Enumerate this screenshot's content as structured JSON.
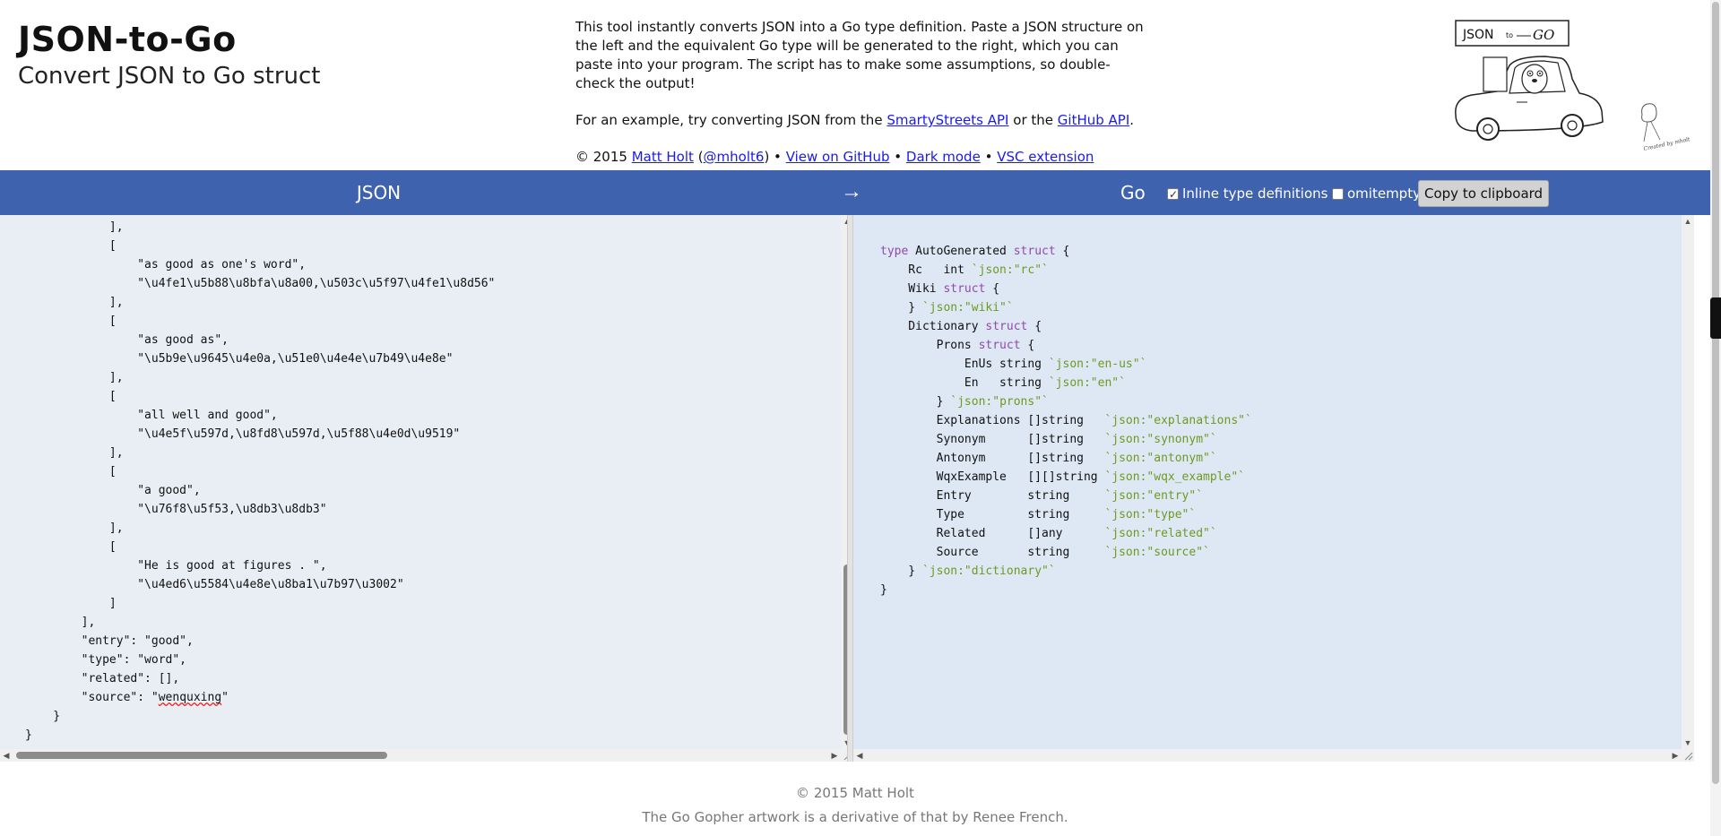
{
  "header": {
    "title": "JSON-to-Go",
    "subtitle": "Convert JSON to Go struct",
    "description": "This tool instantly converts JSON into a Go type definition. Paste a JSON structure on the left and the equivalent Go type will be generated to the right, which you can paste into your program. The script has to make some assumptions, so double-check the output!",
    "example_prefix": "For an example, try converting JSON from the",
    "example_link1": "SmartyStreets API",
    "example_middle": "or the",
    "example_link2": "GitHub API",
    "example_suffix": ".",
    "credits_prefix": "© 2015",
    "author_link": "Matt Holt",
    "handle_open": "(",
    "handle_link": "@mholt6",
    "handle_close": ") •",
    "github_link": "View on GitHub",
    "sep": "•",
    "dark_mode_link": "Dark mode",
    "vsc_link": "VSC extension",
    "logo_text": "JSON",
    "logo_to": "to",
    "logo_go": "GO",
    "logo_caption": "Created by mholt"
  },
  "toolbar": {
    "json_label": "JSON",
    "arrow": "→",
    "go_label": "Go",
    "inline_label": "Inline type definitions",
    "inline_checked": true,
    "omitempty_label": "omitempty",
    "omitempty_checked": false,
    "copy_label": "Copy to clipboard"
  },
  "json_lines": [
    "            ],",
    "            [",
    "                \"as good as one's word\",",
    "                \"\\u4fe1\\u5b88\\u8bfa\\u8a00,\\u503c\\u5f97\\u4fe1\\u8d56\"",
    "            ],",
    "            [",
    "                \"as good as\",",
    "                \"\\u5b9e\\u9645\\u4e0a,\\u51e0\\u4e4e\\u7b49\\u4e8e\"",
    "            ],",
    "            [",
    "                \"all well and good\",",
    "                \"\\u4e5f\\u597d,\\u8fd8\\u597d,\\u5f88\\u4e0d\\u9519\"",
    "            ],",
    "            [",
    "                \"a good\",",
    "                \"\\u76f8\\u5f53,\\u8db3\\u8db3\"",
    "            ],",
    "            [",
    "                \"He is good at figures . \",",
    "                \"\\u4ed6\\u5584\\u4e8e\\u8ba1\\u7b97\\u3002\"",
    "            ]",
    "        ],",
    "        \"entry\": \"good\",",
    "        \"type\": \"word\",",
    "        \"related\": [],",
    "        \"source\": \"wenquxing\"",
    "    }",
    "}"
  ],
  "go_lines": [
    [
      {
        "t": "type",
        "c": "kw"
      },
      {
        "t": " AutoGenerated "
      },
      {
        "t": "struct",
        "c": "kw"
      },
      {
        "t": " {"
      }
    ],
    [
      {
        "t": "    Rc   int "
      },
      {
        "t": "`json:\"rc\"`",
        "c": "tag"
      }
    ],
    [
      {
        "t": "    Wiki "
      },
      {
        "t": "struct",
        "c": "kw"
      },
      {
        "t": " {"
      }
    ],
    [
      {
        "t": "    } "
      },
      {
        "t": "`json:\"wiki\"`",
        "c": "tag"
      }
    ],
    [
      {
        "t": "    Dictionary "
      },
      {
        "t": "struct",
        "c": "kw"
      },
      {
        "t": " {"
      }
    ],
    [
      {
        "t": "        Prons "
      },
      {
        "t": "struct",
        "c": "kw"
      },
      {
        "t": " {"
      }
    ],
    [
      {
        "t": "            EnUs string "
      },
      {
        "t": "`json:\"en-us\"`",
        "c": "tag"
      }
    ],
    [
      {
        "t": "            En   string "
      },
      {
        "t": "`json:\"en\"`",
        "c": "tag"
      }
    ],
    [
      {
        "t": "        } "
      },
      {
        "t": "`json:\"prons\"`",
        "c": "tag"
      }
    ],
    [
      {
        "t": "        Explanations []string   "
      },
      {
        "t": "`json:\"explanations\"`",
        "c": "tag"
      }
    ],
    [
      {
        "t": "        Synonym      []string   "
      },
      {
        "t": "`json:\"synonym\"`",
        "c": "tag"
      }
    ],
    [
      {
        "t": "        Antonym      []string   "
      },
      {
        "t": "`json:\"antonym\"`",
        "c": "tag"
      }
    ],
    [
      {
        "t": "        WqxExample   [][]string "
      },
      {
        "t": "`json:\"wqx_example\"`",
        "c": "tag"
      }
    ],
    [
      {
        "t": "        Entry        string     "
      },
      {
        "t": "`json:\"entry\"`",
        "c": "tag"
      }
    ],
    [
      {
        "t": "        Type         string     "
      },
      {
        "t": "`json:\"type\"`",
        "c": "tag"
      }
    ],
    [
      {
        "t": "        Related      []any      "
      },
      {
        "t": "`json:\"related\"`",
        "c": "tag"
      }
    ],
    [
      {
        "t": "        Source       string     "
      },
      {
        "t": "`json:\"source\"`",
        "c": "tag"
      }
    ],
    [
      {
        "t": "    } "
      },
      {
        "t": "`json:\"dictionary\"`",
        "c": "tag"
      }
    ],
    [
      {
        "t": "}"
      }
    ]
  ],
  "footer": {
    "copyright": "© 2015 Matt Holt",
    "artwork": "The Go Gopher artwork is a derivative of that by Renee French."
  }
}
